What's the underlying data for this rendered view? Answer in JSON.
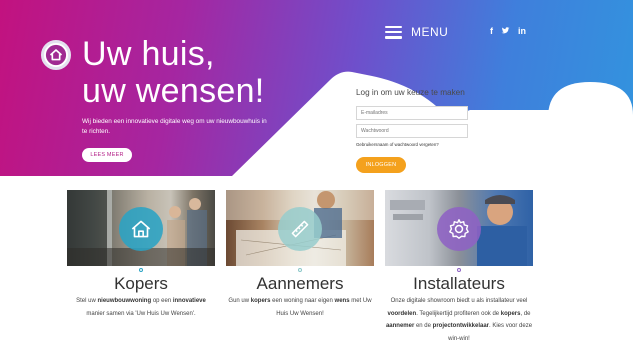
{
  "header": {
    "menu_label": "MENU",
    "social": [
      "f",
      "✦",
      "in"
    ],
    "social_icons": [
      "facebook-icon",
      "twitter-icon",
      "linkedin-icon"
    ]
  },
  "hero": {
    "title_line1": "Uw huis,",
    "title_line2": "uw wensen!",
    "subtitle": "Wij bieden een innovatieve digitale weg om uw nieuwbouwhuis in te richten.",
    "button_label": "LEES MEER"
  },
  "login": {
    "title": "Log in om uw keuze te maken",
    "username_placeholder": "E-mailadres",
    "password_placeholder": "Wachtwoord",
    "forgot_link": "Gebruikersnaam of wachtwoord vergeten?",
    "button_label": "INLOGGEN"
  },
  "cards": [
    {
      "title": "Kopers",
      "text_parts": [
        "Stel uw ",
        "nieuwbouwwoning",
        " op een ",
        "innovatieve",
        " manier samen via 'Uw Huis Uw Wensen'."
      ],
      "icon": "house-icon"
    },
    {
      "title": "Aannemers",
      "text_parts": [
        "Gun uw ",
        "kopers",
        " een woning naar eigen ",
        "wens",
        " met Uw Huis Uw Wensen!"
      ],
      "icon": "ruler-icon"
    },
    {
      "title": "Installateurs",
      "text_parts": [
        "Onze digitale showroom biedt u als installateur veel ",
        "voordelen",
        ". Tegelijkertijd profiteren ook de ",
        "kopers",
        ", de ",
        "aannemer",
        " en de ",
        "projectontwikkelaar",
        ". Kies voor deze win-win!"
      ],
      "icon": "gear-icon"
    }
  ],
  "colors": {
    "gradient_start": "#c2127f",
    "gradient_end": "#3294de",
    "login_button": "#f4a11d",
    "kopers_accent": "#2aa3c4",
    "aannemers_accent": "#8ac7c8",
    "installateurs_accent": "#8e62c4"
  }
}
